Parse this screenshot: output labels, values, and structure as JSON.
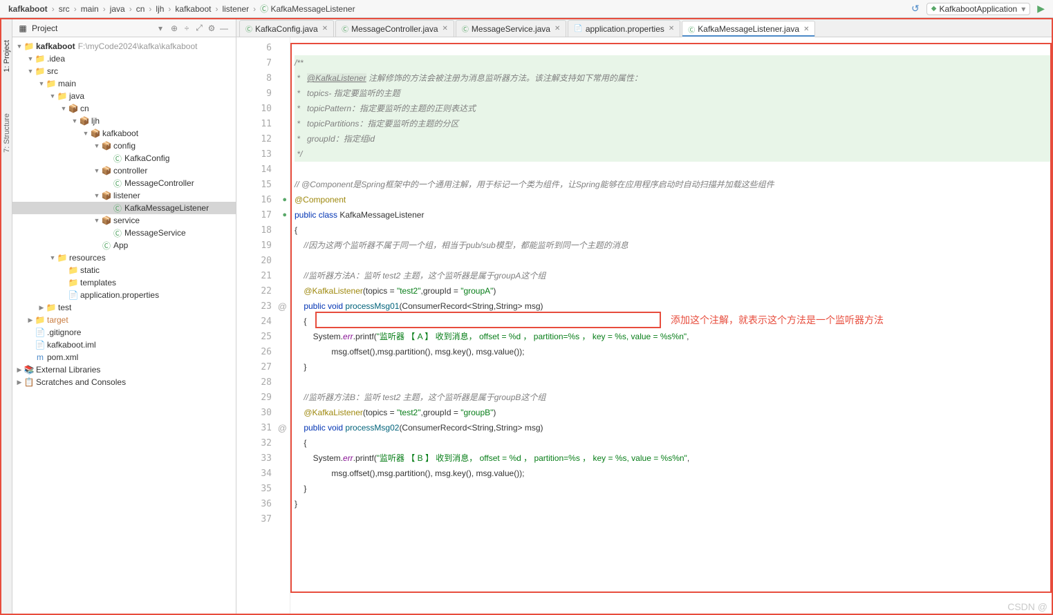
{
  "breadcrumb": {
    "root": "kafkaboot",
    "parts": [
      "src",
      "main",
      "java",
      "cn",
      "ljh",
      "kafkaboot",
      "listener"
    ],
    "current": "KafkaMessageListener",
    "run_config": "KafkabootApplication"
  },
  "sidebar_tabs": {
    "project": "1: Project",
    "structure": "7: Structure"
  },
  "project": {
    "title": "Project",
    "root": "kafkaboot",
    "root_path": "F:\\myCode2024\\kafka\\kafkaboot",
    "tree": [
      {
        "l": 1,
        "arr": "▼",
        "ic": "📁",
        "cls": "fl",
        "lbl": ".idea"
      },
      {
        "l": 1,
        "arr": "▼",
        "ic": "📁",
        "cls": "fl",
        "lbl": "src"
      },
      {
        "l": 2,
        "arr": "▼",
        "ic": "📁",
        "cls": "fl",
        "lbl": "main"
      },
      {
        "l": 3,
        "arr": "▼",
        "ic": "📁",
        "cls": "jf",
        "lbl": "java"
      },
      {
        "l": 4,
        "arr": "▼",
        "ic": "📦",
        "cls": "pk",
        "lbl": "cn"
      },
      {
        "l": 5,
        "arr": "▼",
        "ic": "📦",
        "cls": "pk",
        "lbl": "ljh"
      },
      {
        "l": 6,
        "arr": "▼",
        "ic": "📦",
        "cls": "pk",
        "lbl": "kafkaboot"
      },
      {
        "l": 7,
        "arr": "▼",
        "ic": "📦",
        "cls": "pk",
        "lbl": "config"
      },
      {
        "l": 8,
        "arr": "",
        "ic": "Ⓒ",
        "cls": "cf",
        "lbl": "KafkaConfig"
      },
      {
        "l": 7,
        "arr": "▼",
        "ic": "📦",
        "cls": "pk",
        "lbl": "controller"
      },
      {
        "l": 8,
        "arr": "",
        "ic": "Ⓒ",
        "cls": "cf",
        "lbl": "MessageController"
      },
      {
        "l": 7,
        "arr": "▼",
        "ic": "📦",
        "cls": "pk",
        "lbl": "listener"
      },
      {
        "l": 8,
        "arr": "",
        "ic": "Ⓒ",
        "cls": "cf",
        "lbl": "KafkaMessageListener",
        "sel": true
      },
      {
        "l": 7,
        "arr": "▼",
        "ic": "📦",
        "cls": "pk",
        "lbl": "service"
      },
      {
        "l": 8,
        "arr": "",
        "ic": "Ⓒ",
        "cls": "cf",
        "lbl": "MessageService"
      },
      {
        "l": 7,
        "arr": "",
        "ic": "Ⓒ",
        "cls": "cf",
        "lbl": "App"
      },
      {
        "l": 3,
        "arr": "▼",
        "ic": "📁",
        "cls": "fl",
        "lbl": "resources"
      },
      {
        "l": 4,
        "arr": "",
        "ic": "📁",
        "cls": "fl",
        "lbl": "static"
      },
      {
        "l": 4,
        "arr": "",
        "ic": "📁",
        "cls": "fl",
        "lbl": "templates"
      },
      {
        "l": 4,
        "arr": "",
        "ic": "📄",
        "cls": "cf",
        "lbl": "application.properties"
      },
      {
        "l": 2,
        "arr": "▶",
        "ic": "📁",
        "cls": "fl",
        "lbl": "test"
      },
      {
        "l": 1,
        "arr": "▶",
        "ic": "📁",
        "cls": "fl",
        "lbl": "target",
        "tgt": true
      },
      {
        "l": 1,
        "arr": "",
        "ic": "📄",
        "cls": "",
        "lbl": ".gitignore"
      },
      {
        "l": 1,
        "arr": "",
        "ic": "📄",
        "cls": "",
        "lbl": "kafkaboot.iml"
      },
      {
        "l": 1,
        "arr": "",
        "ic": "m",
        "cls": "mv",
        "lbl": "pom.xml"
      }
    ],
    "ext_lib": "External Libraries",
    "scratches": "Scratches and Consoles"
  },
  "tabs": [
    {
      "ic": "Ⓒ",
      "lbl": "KafkaConfig.java",
      "active": false
    },
    {
      "ic": "Ⓒ",
      "lbl": "MessageController.java",
      "active": false
    },
    {
      "ic": "Ⓒ",
      "lbl": "MessageService.java",
      "active": false
    },
    {
      "ic": "📄",
      "lbl": "application.properties",
      "active": false
    },
    {
      "ic": "Ⓒ",
      "lbl": "KafkaMessageListener.java",
      "active": true
    }
  ],
  "lines": [
    6,
    7,
    8,
    9,
    10,
    11,
    12,
    13,
    14,
    15,
    16,
    17,
    18,
    19,
    20,
    21,
    22,
    23,
    24,
    25,
    26,
    27,
    28,
    29,
    30,
    31,
    32,
    33,
    34,
    35,
    36,
    37
  ],
  "gutter_icons": {
    "16": "●",
    "17": "●",
    "23": "@",
    "31": "@"
  },
  "code": {
    "l7": "/**",
    "l8a": " *   ",
    "l8b": "@KafkaListener",
    "l8c": " 注解修饰的方法会被注册为消息监听器方法。该注解支持如下常用的属性：",
    "l9": " *   topics- 指定要监听的主题",
    "l10": " *   topicPattern：指定要监听的主题的正则表达式",
    "l11": " *   topicPartitions：指定要监听的主题的分区",
    "l12": " *   groupId：指定组id",
    "l13": " */",
    "l15": "// @Component是Spring框架中的一个通用注解，用于标记一个类为组件，让Spring能够在应用程序启动时自动扫描并加载这些组件",
    "l16": "@Component",
    "l17a": "public",
    "l17b": " class ",
    "l17c": "KafkaMessageListener",
    "l18": "{",
    "l19": "    //因为这两个监听器不属于同一个组，相当于pub/sub模型，都能监听到同一个主题的消息",
    "l21": "    //监听器方法A：监听 test2 主题，这个监听器是属于groupA这个组",
    "l22a": "    @KafkaListener",
    "l22b": "(topics = ",
    "l22c": "\"test2\"",
    "l22d": ",groupId = ",
    "l22e": "\"groupA\"",
    "l22f": ")",
    "l23a": "    public",
    "l23b": " void ",
    "l23c": "processMsg01",
    "l23d": "(ConsumerRecord<String,String> msg)",
    "l24": "    {",
    "l25a": "        System.",
    "l25b": "err",
    "l25c": ".printf(",
    "l25d": "\"监听器 【 A 】 收到消息， offset = %d ， partition=%s ， key = %s, value = %s%n\"",
    "l25e": ",",
    "l26": "                msg.offset(),msg.partition(), msg.key(), msg.value());",
    "l27": "    }",
    "l29": "    //监听器方法B：监听 test2 主题，这个监听器是属于groupB这个组",
    "l30a": "    @KafkaListener",
    "l30b": "(topics = ",
    "l30c": "\"test2\"",
    "l30d": ",groupId = ",
    "l30e": "\"groupB\"",
    "l30f": ")",
    "l31a": "    public",
    "l31b": " void ",
    "l31c": "processMsg02",
    "l31d": "(ConsumerRecord<String,String> msg)",
    "l32": "    {",
    "l33a": "        System.",
    "l33b": "err",
    "l33c": ".printf(",
    "l33d": "\"监听器 【 B 】 收到消息， offset = %d ， partition=%s ， key = %s, value = %s%n\"",
    "l33e": ",",
    "l34": "                msg.offset(),msg.partition(), msg.key(), msg.value());",
    "l35": "    }",
    "l36": "}"
  },
  "red_note": "添加这个注解，就表示这个方法是一个监听器方法",
  "watermark": "CSDN @"
}
